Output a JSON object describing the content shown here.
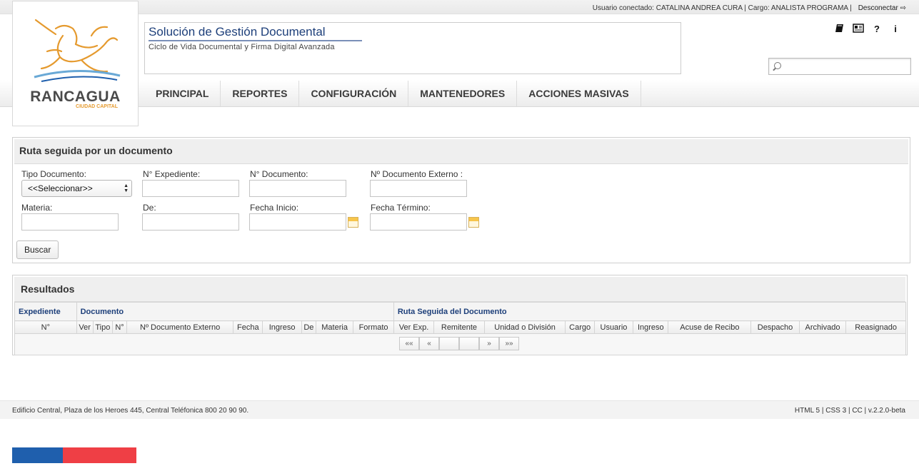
{
  "colors": {
    "accent": "#1d3f7a",
    "flag_blue": "#1f5fad",
    "flag_red": "#ef3f45",
    "logo_gold": "#e59a2e"
  },
  "topbar": {
    "user_info": "Usuario conectado: CATALINA ANDREA CURA | Cargo: ANALISTA PROGRAMA |",
    "logout_label": "Desconectar"
  },
  "logo": {
    "name": "RANCAGUA",
    "subtitle": "CIUDAD CAPITAL"
  },
  "header": {
    "title": "Solución de Gestión Documental",
    "subtitle": "Ciclo de Vida Documental y Firma Digital Avanzada"
  },
  "tools": {
    "icons": [
      "book-icon",
      "news-icon",
      "help-icon",
      "info-icon"
    ],
    "help_glyph": "?",
    "info_glyph": "i"
  },
  "search": {
    "placeholder": ""
  },
  "menu": {
    "items": [
      {
        "label": "PRINCIPAL"
      },
      {
        "label": "REPORTES"
      },
      {
        "label": "CONFIGURACIÓN"
      },
      {
        "label": "MANTENEDORES"
      },
      {
        "label": "ACCIONES MASIVAS"
      }
    ]
  },
  "form": {
    "title": "Ruta seguida por un documento",
    "tipo_documento_label": "Tipo Documento:",
    "tipo_documento_value": "<<Seleccionar>>",
    "expediente_label": "N° Expediente:",
    "documento_label": "N° Documento:",
    "documento_externo_label": "Nº Documento Externo :",
    "materia_label": "Materia:",
    "de_label": "De:",
    "fecha_inicio_label": "Fecha Inicio:",
    "fecha_termino_label": "Fecha Término:",
    "buscar_label": "Buscar"
  },
  "results": {
    "title": "Resultados",
    "groups": [
      "Expediente",
      "Documento",
      "Ruta Seguida del Documento"
    ],
    "columns": [
      "N°",
      "Ver",
      "Tipo",
      "N°",
      "Nº Documento Externo",
      "Fecha",
      "Ingreso",
      "De",
      "Materia",
      "Formato",
      "Ver Exp.",
      "Remitente",
      "Unidad o División",
      "Cargo",
      "Usuario",
      "Ingreso",
      "Acuse de Recibo",
      "Despacho",
      "Archivado",
      "Reasignado"
    ],
    "pager": {
      "first": "««",
      "prev": "«",
      "next": "»",
      "last": "»»"
    }
  },
  "footer": {
    "address": "Edificio Central, Plaza de los Heroes 445, Central Teléfonica 800 20 90 90.",
    "tech": "HTML 5 | CSS 3 | CC | v.2.2.0-beta"
  }
}
